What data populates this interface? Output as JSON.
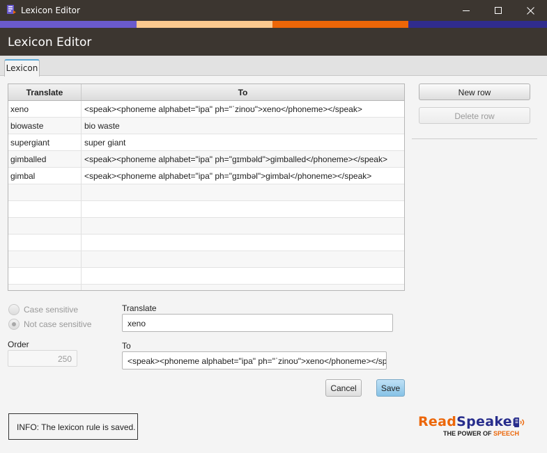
{
  "window": {
    "title": "Lexicon Editor",
    "controls": {
      "minimize": "minimize-icon",
      "maximize": "maximize-icon",
      "close": "close-icon"
    }
  },
  "brand_stripe": [
    "#6a5acd",
    "#fbc98f",
    "#ec6608",
    "#302c8e"
  ],
  "header": {
    "title": "Lexicon Editor"
  },
  "tabs": [
    {
      "label": "Lexicon",
      "selected": true
    }
  ],
  "table": {
    "columns": [
      "Translate",
      "To"
    ],
    "rows": [
      {
        "translate": "xeno",
        "to": "<speak><phoneme alphabet=\"ipa\" ph=\"ˈzinoʊ\">xeno</phoneme></speak>"
      },
      {
        "translate": "biowaste",
        "to": "bio waste"
      },
      {
        "translate": "supergiant",
        "to": "super giant"
      },
      {
        "translate": "gimballed",
        "to": "<speak><phoneme alphabet=\"ipa\" ph=\"gɪmbəld\">gimballed</phoneme></speak>"
      },
      {
        "translate": "gimbal",
        "to": "<speak><phoneme alphabet=\"ipa\" ph=\"gɪmbəl\">gimbal</phoneme></speak>"
      }
    ]
  },
  "actions": {
    "new_row": "New row",
    "delete_row": "Delete row"
  },
  "options": {
    "case_sensitive": "Case sensitive",
    "not_case_sensitive": "Not case sensitive",
    "selected": "not_case_sensitive"
  },
  "order": {
    "label": "Order",
    "value": "250"
  },
  "form": {
    "translate_label": "Translate",
    "translate_value": "xeno",
    "to_label": "To",
    "to_value": "<speak><phoneme alphabet=\"ipa\" ph=\"ˈzinoʊ\">xeno</phoneme></speak>"
  },
  "buttons": {
    "cancel": "Cancel",
    "save": "Save"
  },
  "status": {
    "info": "INFO: The lexicon rule is saved."
  },
  "logo": {
    "read": "Read",
    "speaker": "Speaker",
    "tagline_1": "THE POWER OF ",
    "tagline_2": "SPEECH"
  }
}
